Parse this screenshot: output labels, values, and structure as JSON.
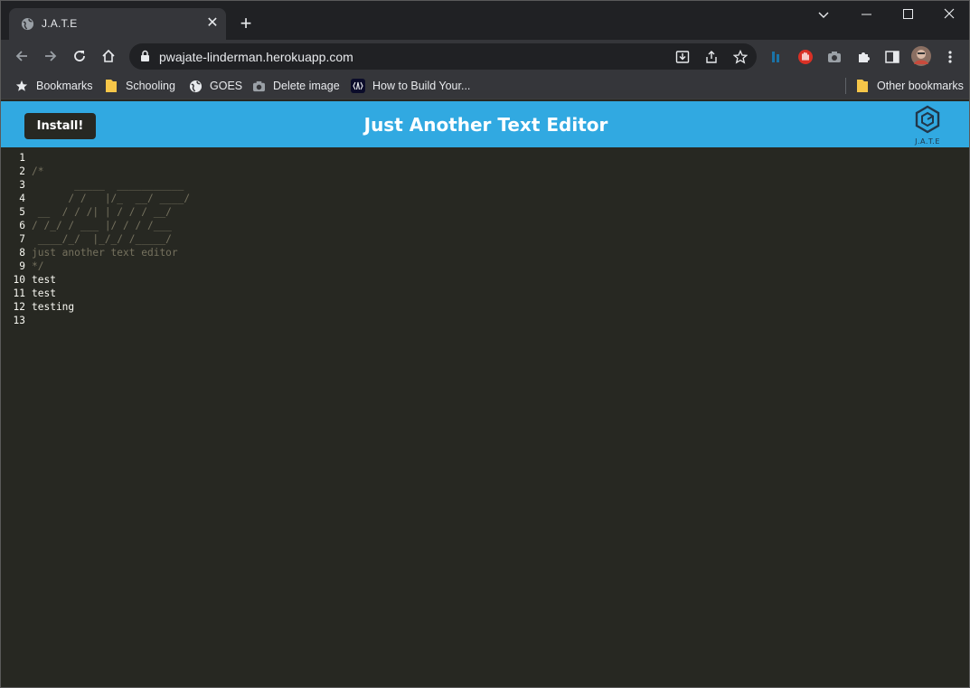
{
  "browser": {
    "tab_title": "J.A.T.E",
    "url": "pwajate-linderman.herokuapp.com",
    "bookmarks": [
      {
        "label": "Bookmarks",
        "icon": "star-icon"
      },
      {
        "label": "Schooling",
        "icon": "folder-icon"
      },
      {
        "label": "GOES",
        "icon": "globe-icon"
      },
      {
        "label": "Delete image",
        "icon": "camera-icon"
      },
      {
        "label": "How to Build Your...",
        "icon": "code-icon"
      }
    ],
    "other_bookmarks": "Other bookmarks"
  },
  "app": {
    "install_label": "Install!",
    "title": "Just Another Text Editor",
    "logo_text": "J.A.T.E"
  },
  "editor": {
    "lines": [
      {
        "n": "1",
        "text": "",
        "kind": "text"
      },
      {
        "n": "2",
        "text": "/*",
        "kind": "comment"
      },
      {
        "n": "3",
        "text": "       _____  ___________",
        "kind": "comment"
      },
      {
        "n": "4",
        "text": "      / /   |/_  __/ ____/",
        "kind": "comment"
      },
      {
        "n": "5",
        "text": " __  / / /| | / / / __/",
        "kind": "comment"
      },
      {
        "n": "6",
        "text": "/ /_/ / ___ |/ / / /___",
        "kind": "comment"
      },
      {
        "n": "7",
        "text": " ____/_/  |_/_/ /_____/",
        "kind": "comment"
      },
      {
        "n": "8",
        "text": "just another text editor",
        "kind": "comment"
      },
      {
        "n": "9",
        "text": "*/",
        "kind": "comment"
      },
      {
        "n": "10",
        "text": "test",
        "kind": "text"
      },
      {
        "n": "11",
        "text": "test",
        "kind": "text"
      },
      {
        "n": "12",
        "text": "testing",
        "kind": "text"
      },
      {
        "n": "13",
        "text": "",
        "kind": "text"
      }
    ]
  },
  "colors": {
    "accent": "#31a9e1",
    "editor_bg": "#272822",
    "comment": "#75715e",
    "text": "#f8f8f2"
  }
}
